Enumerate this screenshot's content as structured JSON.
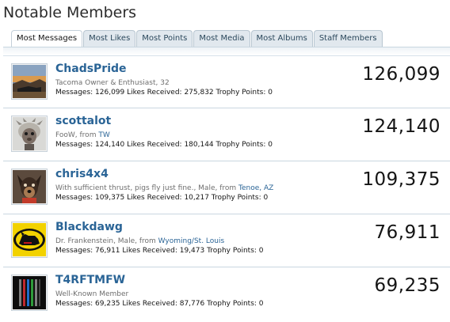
{
  "page": {
    "title": "Notable Members"
  },
  "tabs": [
    {
      "label": "Most Messages",
      "active": true
    },
    {
      "label": "Most Likes",
      "active": false
    },
    {
      "label": "Most Points",
      "active": false
    },
    {
      "label": "Most Media",
      "active": false
    },
    {
      "label": "Most Albums",
      "active": false
    },
    {
      "label": "Staff Members",
      "active": false
    }
  ],
  "members": [
    {
      "username": "ChadsPride",
      "title": "Tacoma Owner & Enthusiast",
      "sep1": ", ",
      "extra": "32",
      "from_label": "",
      "location": "",
      "stats": "Messages: 126,099 Likes Received: 275,832 Trophy Points: 0",
      "score": "126,099",
      "avatar_icon": "landscape-photo-avatar"
    },
    {
      "username": "scottalot",
      "title": "FooW",
      "sep1": ", ",
      "extra": "",
      "from_label": "from ",
      "location": "TW",
      "stats": "Messages: 124,140 Likes Received: 180,144 Trophy Points: 0",
      "score": "124,140",
      "avatar_icon": "fluffy-creature-avatar"
    },
    {
      "username": "chris4x4",
      "title": "With sufficient thrust, pigs fly just fine.",
      "sep1": ", ",
      "extra": "Male",
      "from_label": ", from ",
      "location": "Tenoe, AZ",
      "stats": "Messages: 109,375 Likes Received: 10,217 Trophy Points: 0",
      "score": "109,375",
      "avatar_icon": "dog-photo-avatar"
    },
    {
      "username": "Blackdawg",
      "title": "Dr. Frankenstein",
      "sep1": ", ",
      "extra": "Male",
      "from_label": ", from ",
      "location": "Wyoming/St. Louis",
      "stats": "Messages: 76,911 Likes Received: 19,473 Trophy Points: 0",
      "score": "76,911",
      "avatar_icon": "black-dog-logo-avatar"
    },
    {
      "username": "T4RFTMFW",
      "title": "Well-Known Member",
      "sep1": "",
      "extra": "",
      "from_label": "",
      "location": "",
      "stats": "Messages: 69,235 Likes Received: 87,776 Trophy Points: 0",
      "score": "69,235",
      "avatar_icon": "striped-flag-avatar"
    }
  ]
}
